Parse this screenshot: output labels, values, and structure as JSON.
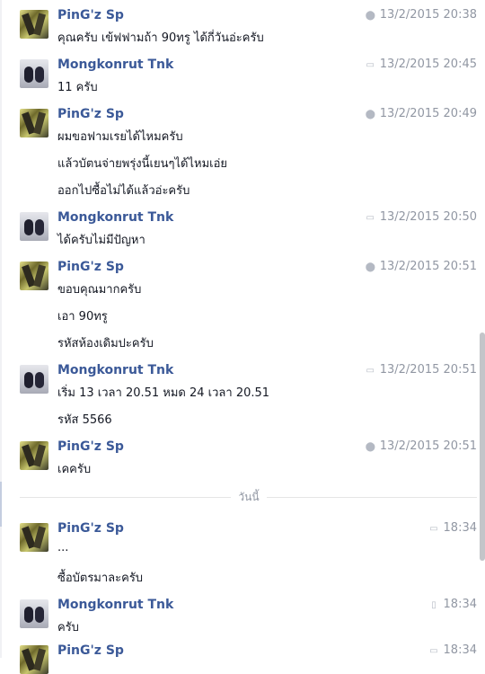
{
  "divider_label": "วันนี้",
  "messages": [
    {
      "sender": "PinG'z Sp",
      "avatar": "ping",
      "time_icon": "location-pin-icon",
      "time": "13/2/2015 20:38",
      "lines": [
        "คุณครับ เข้ฟฟามถ้า 90ทรู ได้กี่วันอ่ะครับ"
      ]
    },
    {
      "sender": "Mongkonrut Tnk",
      "avatar": "mong",
      "time_icon": "chat-bubble-icon",
      "time": "13/2/2015 20:45",
      "lines": [
        "11 ครับ"
      ]
    },
    {
      "sender": "PinG'z Sp",
      "avatar": "ping",
      "time_icon": "location-pin-icon",
      "time": "13/2/2015 20:49",
      "lines": [
        "ผมขอฟามเรยได้ไหมครับ",
        "แล้วบัตนจ่ายพรุ่งนี้เยนๆได้ไหมเอ่ย",
        "ออกไปซื้อไม่ได้แล้วอ่ะครับ"
      ]
    },
    {
      "sender": "Mongkonrut Tnk",
      "avatar": "mong",
      "time_icon": "chat-bubble-icon",
      "time": "13/2/2015 20:50",
      "lines": [
        "ได้ครับไม่มีปัญหา"
      ]
    },
    {
      "sender": "PinG'z Sp",
      "avatar": "ping",
      "time_icon": "location-pin-icon",
      "time": "13/2/2015 20:51",
      "lines": [
        "ขอบคุณมากครับ",
        "เอา 90ทรู",
        "รหัสห้องเดิมปะครับ"
      ]
    },
    {
      "sender": "Mongkonrut Tnk",
      "avatar": "mong",
      "time_icon": "chat-bubble-icon",
      "time": "13/2/2015 20:51",
      "lines": [
        "เริ่ม 13 เวลา 20.51 หมด 24 เวลา 20.51",
        "รหัส 5566"
      ]
    },
    {
      "sender": "PinG'z Sp",
      "avatar": "ping",
      "time_icon": "location-pin-icon",
      "time": "13/2/2015 20:51",
      "lines": [
        "เคครับ"
      ]
    },
    {
      "sender": "PinG'z Sp",
      "avatar": "ping",
      "time_icon": "chat-bubble-icon",
      "time": "18:34",
      "lines": [
        "...",
        "ซื้อบัตรมาละครับ"
      ]
    },
    {
      "sender": "Mongkonrut Tnk",
      "avatar": "mong",
      "time_icon": "mobile-phone-icon",
      "time": "18:34",
      "lines": [
        "ครับ"
      ]
    },
    {
      "sender": "PinG'z Sp",
      "avatar": "ping",
      "time_icon": "chat-bubble-icon",
      "time": "18:34",
      "lines": []
    }
  ]
}
